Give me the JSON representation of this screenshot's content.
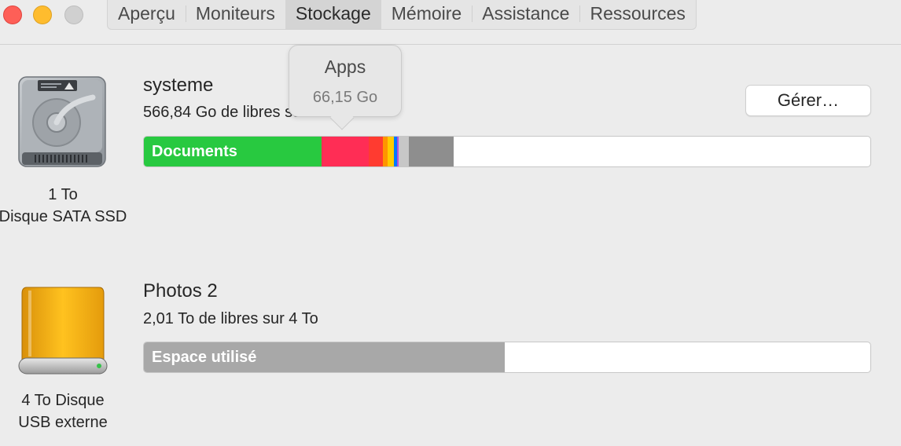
{
  "window": {
    "tabs": [
      {
        "label": "Aperçu"
      },
      {
        "label": "Moniteurs"
      },
      {
        "label": "Stockage"
      },
      {
        "label": "Mémoire"
      },
      {
        "label": "Assistance"
      },
      {
        "label": "Ressources"
      }
    ],
    "active_tab": "Stockage"
  },
  "disks": [
    {
      "name": "systeme",
      "free_text": "566,84 Go de libres sur 1 To",
      "caption_line1": "1 To",
      "caption_line2": "Disque SATA SSD",
      "manage_label": "Gérer…",
      "segments": [
        {
          "label": "Documents",
          "color": "#28c940",
          "fraction": 0.245
        },
        {
          "label": "",
          "color": "#ff2d55",
          "fraction": 0.064
        },
        {
          "label": "",
          "color": "#ff3b30",
          "fraction": 0.02
        },
        {
          "label": "",
          "color": "#ff9500",
          "fraction": 0.006
        },
        {
          "label": "",
          "color": "#ffcc00",
          "fraction": 0.009
        },
        {
          "label": "",
          "color": "#007aff",
          "fraction": 0.004
        },
        {
          "label": "",
          "color": "#af52de",
          "fraction": 0.003
        },
        {
          "label": "",
          "color": "#c7c7c7",
          "fraction": 0.014
        },
        {
          "label": "",
          "color": "#8e8e8e",
          "fraction": 0.062
        }
      ],
      "tooltip": {
        "title": "Apps",
        "value": "66,15 Go"
      }
    },
    {
      "name": "Photos 2",
      "free_text": "2,01 To de libres sur 4 To",
      "caption_line1": "4 To Disque",
      "caption_line2": "USB externe",
      "segments": [
        {
          "label": "Espace utilisé",
          "color": "#a8a8a8",
          "fraction": 0.497
        }
      ]
    }
  ]
}
